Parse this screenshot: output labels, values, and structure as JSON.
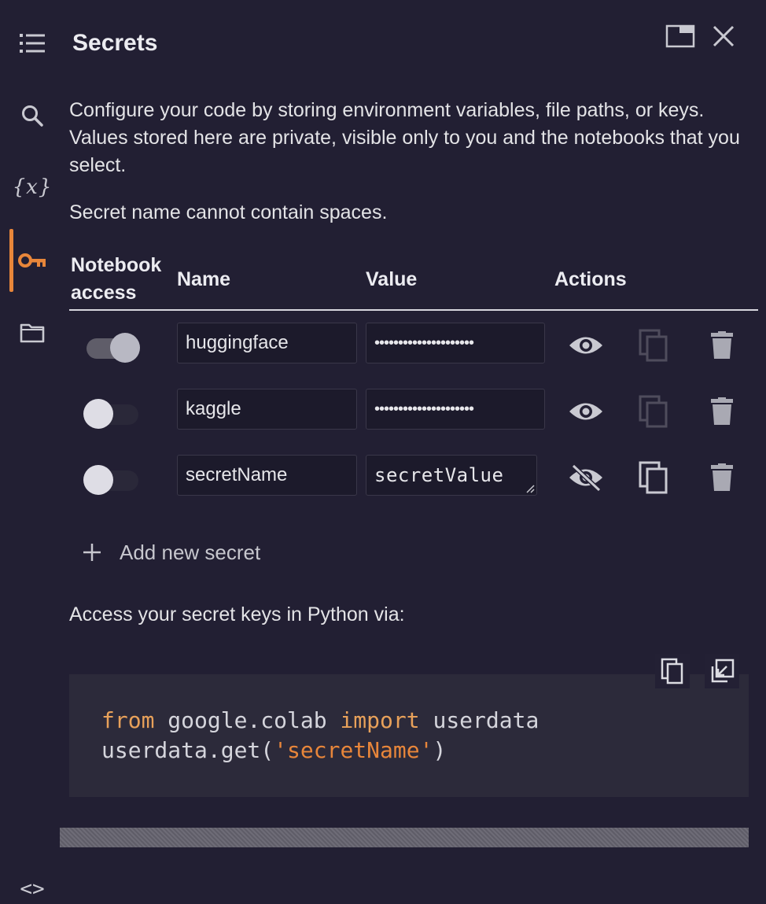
{
  "panel": {
    "title": "Secrets",
    "description": "Configure your code by storing environment variables, file paths, or keys. Values stored here are private, visible only to you and the notebooks that you select.",
    "note": "Secret name cannot contain spaces."
  },
  "rail": {
    "items": [
      {
        "icon": "toc-icon"
      },
      {
        "icon": "search-icon"
      },
      {
        "icon": "variables-icon",
        "glyph": "{x}"
      },
      {
        "icon": "key-icon",
        "active": true
      },
      {
        "icon": "folder-icon"
      }
    ],
    "bottom_glyph": "<>"
  },
  "table": {
    "headers": {
      "notebook_access_line1": "Notebook",
      "notebook_access_line2": "access",
      "name": "Name",
      "value": "Value",
      "actions": "Actions"
    },
    "rows": [
      {
        "access": true,
        "name": "huggingface",
        "value": "•••••••••••••••••••••",
        "visible": false
      },
      {
        "access": false,
        "name": "kaggle",
        "value": "•••••••••••••••••••••",
        "visible": false
      },
      {
        "access": false,
        "name": "secretName",
        "value": "secretValue",
        "visible": true
      }
    ]
  },
  "add_secret_label": "Add new secret",
  "access_label": "Access your secret keys in Python via:",
  "code": {
    "line1_kw1": "from",
    "line1_mid": " google.colab ",
    "line1_kw2": "import",
    "line1_end": " userdata",
    "line2_start": "userdata.get(",
    "line2_str": "'secretName'",
    "line2_end": ")"
  },
  "colors": {
    "background": "#221f33",
    "accent": "#e8863a",
    "code_background": "#2c2a3a"
  }
}
